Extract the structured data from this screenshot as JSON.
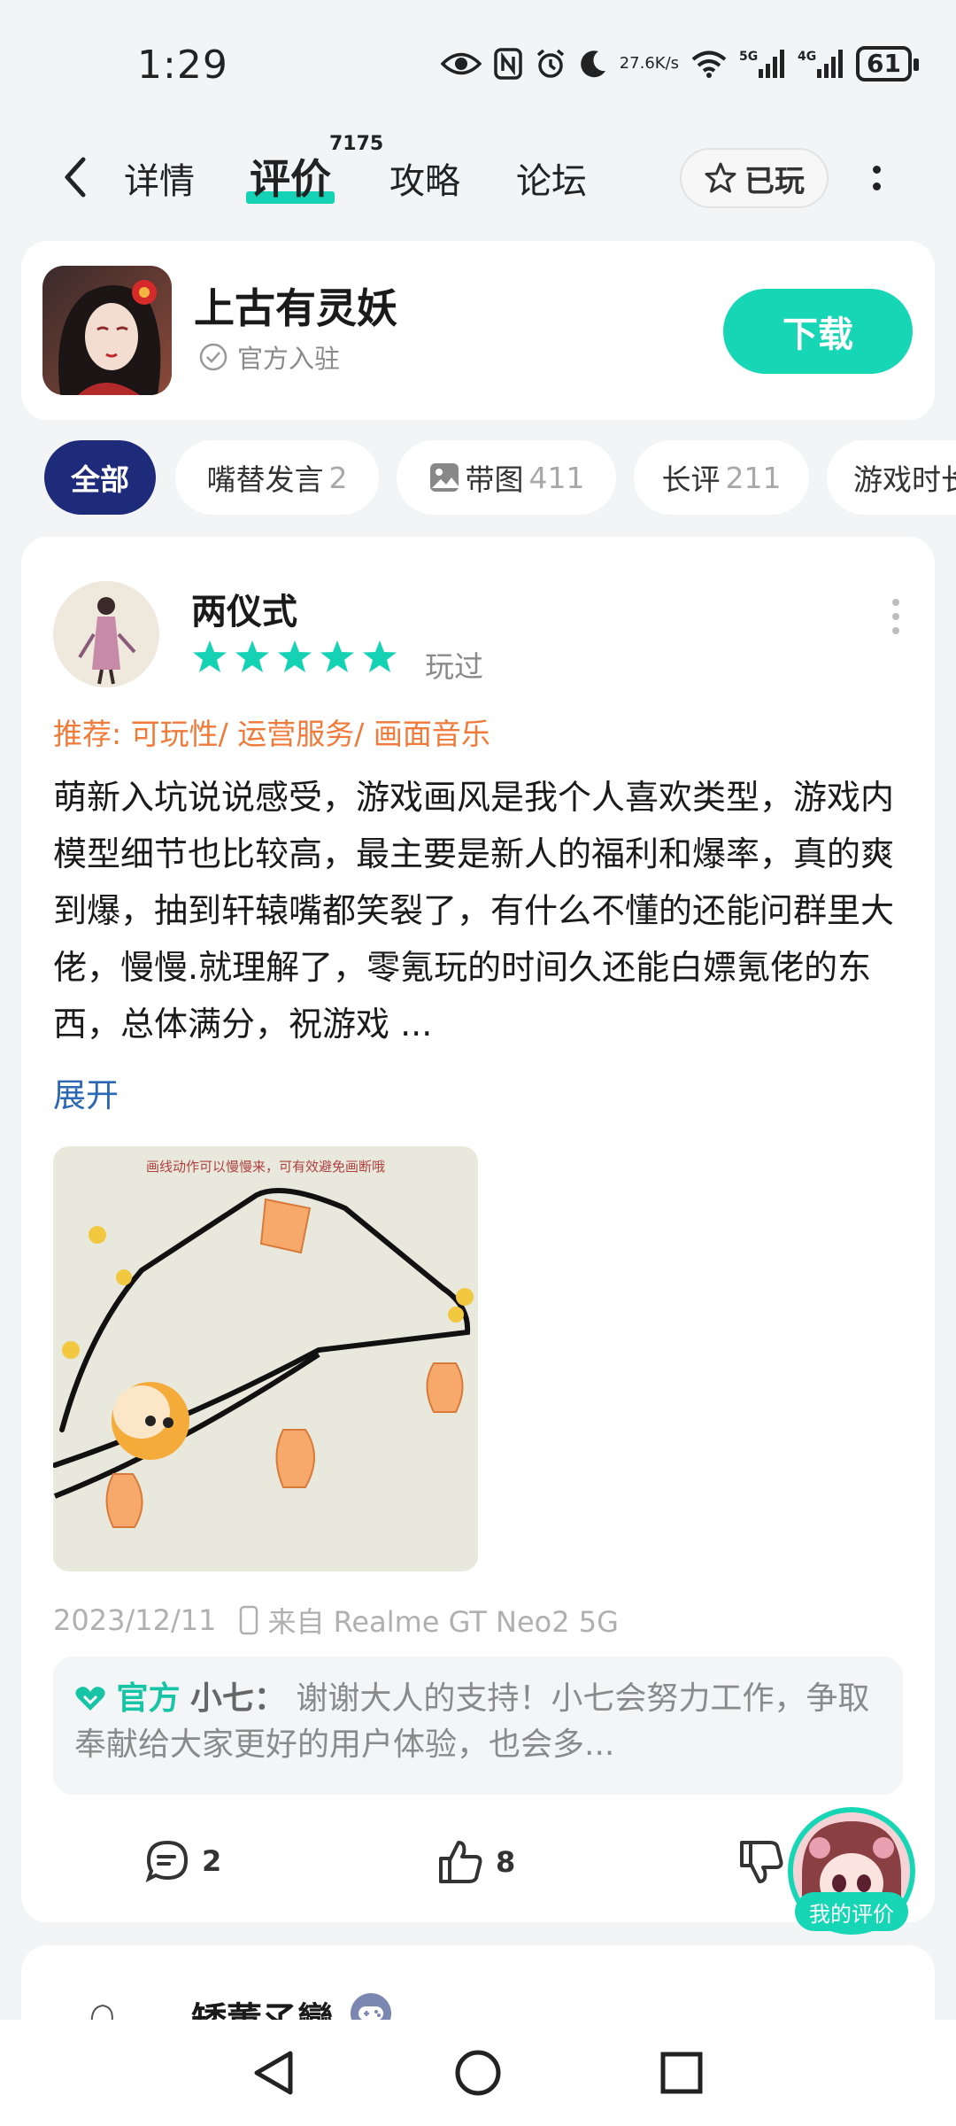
{
  "status_bar": {
    "time": "1:29",
    "net_speed_value": "27.6",
    "net_speed_unit": "K/s",
    "sig1": "5G",
    "sig2": "4G",
    "battery": "61"
  },
  "nav": {
    "tabs": [
      "详情",
      "评价",
      "攻略",
      "论坛"
    ],
    "review_count": "7175",
    "played_label": "已玩"
  },
  "game": {
    "title": "上古有灵妖",
    "official_label": "官方入驻",
    "download_label": "下载"
  },
  "filters": [
    {
      "label": "全部",
      "count": ""
    },
    {
      "label": "嘴替发言",
      "count": "2"
    },
    {
      "label": "带图",
      "count": "411"
    },
    {
      "label": "长评",
      "count": "211"
    },
    {
      "label": "游戏时长",
      "count": ""
    }
  ],
  "review": {
    "name": "两仪式",
    "rating": 5,
    "played_tag": "玩过",
    "recommend": "推荐: 可玩性/ 运营服务/ 画面音乐",
    "text": "萌新入坑说说感受，游戏画风是我个人喜欢类型，游戏内模型细节也比较高，最主要是新人的福利和爆率，真的爽到爆，抽到轩辕嘴都笑裂了，有什么不懂的还能问群里大佬，慢慢.就理解了，零氪玩的时间久还能白嫖氪佬的东西，总体满分，祝游戏 ...",
    "expand_label": "展开",
    "image_caption": "画线动作可以慢慢来，可有效避免画断哦",
    "date": "2023/12/11",
    "device": "来自 Realme GT Neo2 5G",
    "reply": {
      "official_tag": "官方",
      "replier": "小七：",
      "text": "谢谢大人的支持！小七会努力工作，争取奉献给大家更好的用户体验，也会多..."
    },
    "comments": "2",
    "likes": "8"
  },
  "review2": {
    "name": "矮董孓巒"
  },
  "floating": {
    "label": "我的评价"
  },
  "colors": {
    "accent": "#17d6b6",
    "chip_active": "#1e2b7a",
    "recommend": "#f07a3a",
    "link": "#2a68b5"
  }
}
